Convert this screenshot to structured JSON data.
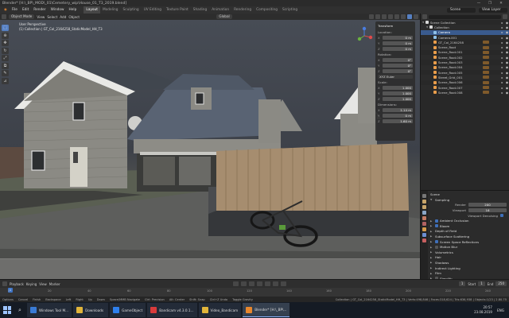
{
  "window": {
    "title": "Blender* [H:\\_BP\\_MOD\\_01\\Cemetery_wip\\House_01_T3_2019.blend]",
    "controls": [
      "—",
      "❐",
      "✕"
    ]
  },
  "menubar": {
    "menus": [
      "File",
      "Edit",
      "Render",
      "Window",
      "Help"
    ],
    "workspaces": [
      "Layout",
      "Modeling",
      "Sculpting",
      "UV Editing",
      "Texture Paint",
      "Shading",
      "Animation",
      "Rendering",
      "Compositing",
      "Scripting"
    ],
    "active_workspace": "Layout",
    "scene_label": "Scene",
    "view_layer_label": "View Layer"
  },
  "viewport_header": {
    "mode": "Object Mode",
    "menus": [
      "View",
      "Select",
      "Add",
      "Object"
    ],
    "orientation": "Global"
  },
  "viewport": {
    "info_line1": "User Perspective",
    "info_line2": "(1) Collection | GT_Col_2164258_StaticModel_HH_T3",
    "tools": [
      "select-box",
      "cursor",
      "move",
      "rotate",
      "scale",
      "transform",
      "annotate",
      "measure"
    ]
  },
  "transform_panel": {
    "title": "Transform",
    "location_label": "Location:",
    "location": [
      [
        "X",
        "0 m"
      ],
      [
        "Y",
        "0 m"
      ],
      [
        "Z",
        "0 m"
      ]
    ],
    "rotation_label": "Rotation:",
    "rotation": [
      [
        "X",
        "0°"
      ],
      [
        "Y",
        "0°"
      ],
      [
        "Z",
        "0°"
      ]
    ],
    "rotation_mode": "XYZ Euler",
    "scale_label": "Scale:",
    "scale": [
      [
        "X",
        "1.000"
      ],
      [
        "Y",
        "1.000"
      ],
      [
        "Z",
        "1.000"
      ]
    ],
    "dimensions_label": "Dimensions:",
    "dimensions": [
      [
        "X",
        "1.14 m"
      ],
      [
        "Y",
        "0 m"
      ],
      [
        "Z",
        "1.60 m"
      ]
    ]
  },
  "outliner": {
    "rows": [
      {
        "name": "Scene Collection",
        "indent": 0,
        "type": "collection",
        "selected": false,
        "extra": false
      },
      {
        "name": "Collection",
        "indent": 1,
        "type": "collection",
        "selected": false,
        "extra": false
      },
      {
        "name": "Camera",
        "indent": 2,
        "type": "camera",
        "selected": true,
        "extra": false
      },
      {
        "name": "Camera.001",
        "indent": 2,
        "type": "camera",
        "selected": false,
        "extra": false
      },
      {
        "name": "GT_Col_2164258",
        "indent": 2,
        "type": "mesh",
        "selected": false,
        "extra": true
      },
      {
        "name": "Scene_Root",
        "indent": 2,
        "type": "mesh",
        "selected": false,
        "extra": true
      },
      {
        "name": "Scene_Root.001",
        "indent": 2,
        "type": "mesh",
        "selected": false,
        "extra": true
      },
      {
        "name": "Scene_Root.002",
        "indent": 2,
        "type": "mesh",
        "selected": false,
        "extra": true
      },
      {
        "name": "Scene_Root.003",
        "indent": 2,
        "type": "mesh",
        "selected": false,
        "extra": true
      },
      {
        "name": "Scene_Root.004",
        "indent": 2,
        "type": "mesh",
        "selected": false,
        "extra": true
      },
      {
        "name": "Scene_Root.005",
        "indent": 2,
        "type": "mesh",
        "selected": false,
        "extra": true
      },
      {
        "name": "Street_Grid_001",
        "indent": 2,
        "type": "mesh",
        "selected": false,
        "extra": true
      },
      {
        "name": "Scene_Root.006",
        "indent": 2,
        "type": "mesh",
        "selected": false,
        "extra": true
      },
      {
        "name": "Scene_Root.007",
        "indent": 2,
        "type": "mesh",
        "selected": false,
        "extra": true
      },
      {
        "name": "Scene_Root.008",
        "indent": 2,
        "type": "mesh",
        "selected": false,
        "extra": true
      }
    ]
  },
  "properties": {
    "header": "Scene",
    "sampling_label": "Sampling",
    "render_label": "Render",
    "render_value": "200",
    "viewport_label": "Viewport",
    "viewport_value": "16",
    "viewport_denoising": "Viewport Denoising",
    "sections": [
      {
        "label": "Ambient Occlusion",
        "check": true
      },
      {
        "label": "Bloom",
        "check": true
      },
      {
        "label": "Depth of Field",
        "check": null
      },
      {
        "label": "Subsurface Scattering",
        "check": null
      },
      {
        "label": "Screen Space Reflections",
        "check": true
      },
      {
        "label": "Motion Blur",
        "check": false
      },
      {
        "label": "Volumetrics",
        "check": null
      },
      {
        "label": "Hair",
        "check": null
      },
      {
        "label": "Shadows",
        "check": null
      },
      {
        "label": "Indirect Lighting",
        "check": null
      },
      {
        "label": "Film",
        "check": null
      },
      {
        "label": "Simplify",
        "check": false
      },
      {
        "label": "Freestyle",
        "check": false
      }
    ]
  },
  "timeline": {
    "menus": [
      "Playback",
      "Keying",
      "View",
      "Marker"
    ],
    "current_frame": "1",
    "start_label": "Start",
    "start": "1",
    "end_label": "End",
    "end": "250",
    "ticks": [
      "0",
      "20",
      "40",
      "60",
      "80",
      "100",
      "120",
      "140",
      "160",
      "180",
      "200",
      "220",
      "240"
    ]
  },
  "statusbar": {
    "items": [
      "Options",
      "Cancel",
      "Finish",
      "Backspace",
      "Left",
      "Right",
      "Up",
      "Down",
      "Space/MMB Navigate",
      "Ctrl: Precision",
      "Alt: Center",
      "Shift: Snap",
      "Ctrl+Z Undo",
      "Toggle Gravity"
    ],
    "stats": "Collection | GT_Col_2164258_StaticModel_HH_T3 | Verts:498,846 | Faces:318,624 | Tris:636,938 | Objects:1/23 | 2.80.75"
  },
  "taskbar": {
    "tasks": [
      {
        "label": "Windows Tool M...",
        "color": "#3a7bd5",
        "active": false
      },
      {
        "label": "Downloads",
        "color": "#e1b53a",
        "active": false
      },
      {
        "label": "GameObject",
        "color": "#2f80ed",
        "active": false
      },
      {
        "label": "Bandicam v4.3.0.1...",
        "color": "#d93b3b",
        "active": false
      },
      {
        "label": "Video_Bandicam",
        "color": "#e1b53a",
        "active": false
      },
      {
        "label": "Blender* [H:\\_BP\\...",
        "color": "#e8872d",
        "active": true
      }
    ],
    "time": "20:57",
    "date": "23.08.2019",
    "lang": "ENG"
  },
  "colors": {
    "accent": "#3f74c5",
    "selection": "#3a5b8e",
    "panel": "#2b2b2b"
  }
}
